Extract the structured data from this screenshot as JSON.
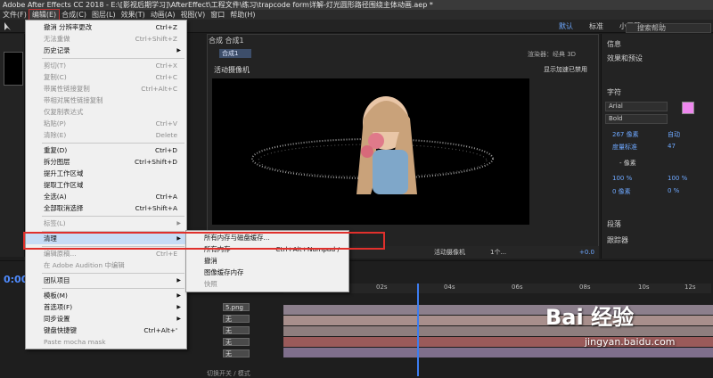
{
  "title": "Adobe After Effects CC 2018 - E:\\[影视后期学习]\\AfterEffect\\工程文件\\练习\\trapcode form详解-灯光圆形路径围绕主体动画.aep *",
  "menubar": [
    "文件(F)",
    "编辑(E)",
    "合成(C)",
    "图层(L)",
    "效果(T)",
    "动画(A)",
    "视图(V)",
    "窗口",
    "帮助(H)"
  ],
  "workspaces": [
    "默认",
    "标准",
    "小屏幕",
    "库"
  ],
  "help_placeholder": "搜索帮助",
  "comp": {
    "panel_title": "合成 合成1",
    "tab": "合成1",
    "renderer": "渲染器：经典 3D",
    "active_camera": "活动摄像机",
    "gpu_notice": "显示加速已禁用",
    "bottom_camera": "活动摄像机",
    "bottom_view": "1个...",
    "bottom_value": "+0.0"
  },
  "edit_menu": [
    {
      "label": "撤消 分辨率更改",
      "shortcut": "Ctrl+Z",
      "disabled": false
    },
    {
      "label": "无法重做",
      "shortcut": "Ctrl+Shift+Z",
      "disabled": true
    },
    {
      "label": "历史记录",
      "shortcut": "",
      "disabled": false,
      "submenu": true
    },
    {
      "label": "剪切(T)",
      "shortcut": "Ctrl+X",
      "disabled": true
    },
    {
      "label": "复制(C)",
      "shortcut": "Ctrl+C",
      "disabled": true
    },
    {
      "label": "带属性链接复制",
      "shortcut": "Ctrl+Alt+C",
      "disabled": true
    },
    {
      "label": "带相对属性链接复制",
      "shortcut": "",
      "disabled": true
    },
    {
      "label": "仅复制表达式",
      "shortcut": "",
      "disabled": true
    },
    {
      "label": "粘贴(P)",
      "shortcut": "Ctrl+V",
      "disabled": true
    },
    {
      "label": "清除(E)",
      "shortcut": "Delete",
      "disabled": true
    },
    {
      "label": "重复(D)",
      "shortcut": "Ctrl+D",
      "disabled": false
    },
    {
      "label": "拆分图层",
      "shortcut": "Ctrl+Shift+D",
      "disabled": false
    },
    {
      "label": "提升工作区域",
      "shortcut": "",
      "disabled": false
    },
    {
      "label": "提取工作区域",
      "shortcut": "",
      "disabled": false
    },
    {
      "label": "全选(A)",
      "shortcut": "Ctrl+A",
      "disabled": false
    },
    {
      "label": "全部取消选择",
      "shortcut": "Ctrl+Shift+A",
      "disabled": false
    },
    {
      "label": "标签(L)",
      "shortcut": "",
      "disabled": true,
      "submenu": true
    },
    {
      "label": "清理",
      "shortcut": "",
      "disabled": false,
      "submenu": true
    },
    {
      "label": "编辑原稿...",
      "shortcut": "Ctrl+E",
      "disabled": true
    },
    {
      "label": "在 Adobe Audition 中编辑",
      "shortcut": "",
      "disabled": true
    },
    {
      "label": "团队项目",
      "shortcut": "",
      "disabled": false,
      "submenu": true
    },
    {
      "label": "模板(M)",
      "shortcut": "",
      "disabled": false,
      "submenu": true
    },
    {
      "label": "首选项(F)",
      "shortcut": "",
      "disabled": false,
      "submenu": true
    },
    {
      "label": "同步设置",
      "shortcut": "",
      "disabled": false,
      "submenu": true
    },
    {
      "label": "键盘快捷键",
      "shortcut": "Ctrl+Alt+'",
      "disabled": false
    },
    {
      "label": "Paste mocha mask",
      "shortcut": "",
      "disabled": true
    }
  ],
  "purge_submenu": [
    {
      "label": "所有内存与磁盘缓存...",
      "shortcut": "",
      "disabled": false
    },
    {
      "label": "所有内存",
      "shortcut": "Ctrl+Alt+Numpad /",
      "disabled": false
    },
    {
      "label": "撤消",
      "shortcut": "",
      "disabled": false
    },
    {
      "label": "图像缓存内存",
      "shortcut": "",
      "disabled": false
    },
    {
      "label": "快照",
      "shortcut": "",
      "disabled": true
    }
  ],
  "right_panel": {
    "info": "信息",
    "effects": "效果和预设",
    "character": "字符",
    "font": "Arial",
    "style": "Bold",
    "leading": "自动",
    "tracking_label": "像素",
    "size": "267 像素",
    "kerning": "度量标准",
    "tracking": "47",
    "stroke": "- 像素",
    "scale_v": "100 %",
    "scale_h": "100 %",
    "baseline": "0 像素",
    "tsume": "0 %",
    "paragraph": "段落",
    "tracker": "跟踪器"
  },
  "timeline": {
    "timecode": "0:00",
    "ruler": [
      "0s",
      "02s",
      "04s",
      "06s",
      "08s",
      "10s",
      "12s"
    ],
    "layer_name": "5.png",
    "parent": "无",
    "footer": "切换开关 / 模式"
  },
  "watermark": {
    "brand": "Bai 经验",
    "url": "jingyan.baidu.com"
  },
  "colors": {
    "accent": "#3d7df0",
    "highlight_box": "#e0302c"
  }
}
